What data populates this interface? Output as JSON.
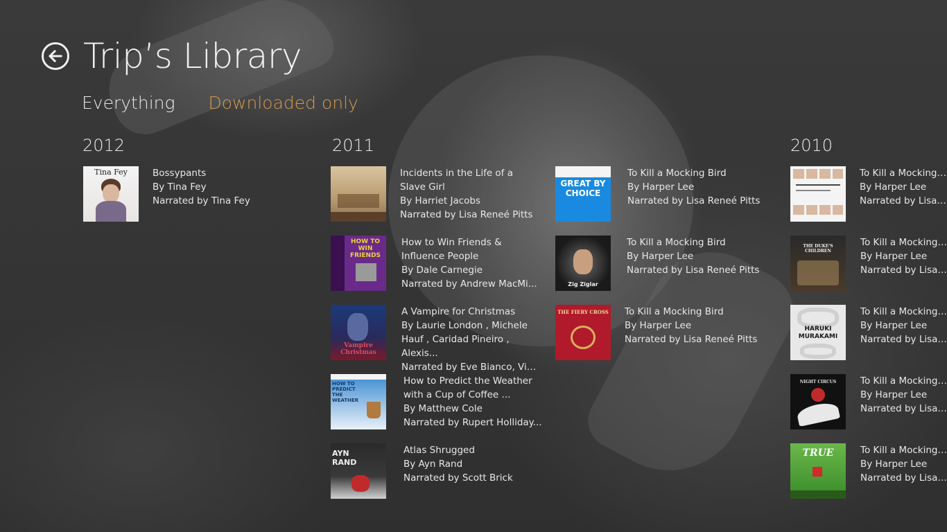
{
  "header": {
    "title": "Trip’s Library",
    "back_icon": "back-arrow-icon"
  },
  "filters": [
    {
      "label": "Everything",
      "active": false
    },
    {
      "label": "Downloaded only",
      "active": true
    }
  ],
  "accent_color": "#d49a4e",
  "groups": [
    {
      "year": "2012",
      "items": [
        {
          "cover_text": "Tina Fey",
          "title": "Bossypants",
          "author": "By Tina Fey",
          "narrator": "Narrated by Tina Fey"
        }
      ]
    },
    {
      "year": "2011",
      "items": [
        {
          "title": "Incidents in the Life of a Slave Girl",
          "author": "By Harriet Jacobs",
          "narrator": "Narrated by Lisa Reneé Pitts"
        },
        {
          "cover_text": "HOW TO WIN FRIENDS",
          "title": "How to Win Friends & Influence People",
          "author": "By Dale Carnegie",
          "narrator": "Narrated by Andrew MacMi..."
        },
        {
          "cover_text": "Vampire Christmas",
          "title": "A Vampire for Christmas",
          "author": "By Laurie London , Michele Hauf , Caridad Pineiro , Alexis...",
          "narrator": "Narrated by Eve Bianco, Viv Wi..."
        },
        {
          "cover_text": "HOW TO PREDICT THE WEATHER",
          "title": "How to Predict the Weather with a Cup of Coffee ...",
          "author": "By Matthew Cole",
          "narrator": "Narrated by Rupert Holliday..."
        },
        {
          "cover_text": "AYN RAND",
          "title": "Atlas Shrugged",
          "author": "By Ayn Rand",
          "narrator": "Narrated by Scott Brick"
        },
        {
          "cover_text": "GREAT BY CHOICE",
          "title": "To Kill a Mocking Bird",
          "author": "By Harper Lee",
          "narrator": "Narrated by Lisa Reneé Pitts"
        },
        {
          "cover_text": "Zig Ziglar",
          "title": "To Kill a Mocking Bird",
          "author": "By Harper Lee",
          "narrator": "Narrated by Lisa Reneé Pitts"
        },
        {
          "cover_text": "THE FIERY CROSS",
          "title": "To Kill a Mocking Bird",
          "author": "By Harper Lee",
          "narrator": "Narrated by Lisa Reneé Pitts"
        }
      ]
    },
    {
      "year": "2010",
      "items": [
        {
          "title": "To Kill a Mocking Bird",
          "author": "By Harper Lee",
          "narrator": "Narrated by Lisa Rene"
        },
        {
          "cover_text": "THE DUKE'S CHILDREN",
          "title": "To Kill a Mocking Bird",
          "author": "By Harper Lee",
          "narrator": "Narrated by Lisa Rene"
        },
        {
          "cover_text": "HARUKI MURAKAMI",
          "title": "To Kill a Mocking Bird",
          "author": "By Harper Lee",
          "narrator": "Narrated by Lisa Rene"
        },
        {
          "cover_text": "NIGHT CIRCUS",
          "title": "To Kill a Mocking Bird",
          "author": "By Harper Lee",
          "narrator": "Narrated by Lisa Rene"
        },
        {
          "cover_text": "TRUE",
          "title": "To Kill a Mocking Bird",
          "author": "By Harper Lee",
          "narrator": "Narrated by Lisa Rene"
        }
      ]
    }
  ]
}
